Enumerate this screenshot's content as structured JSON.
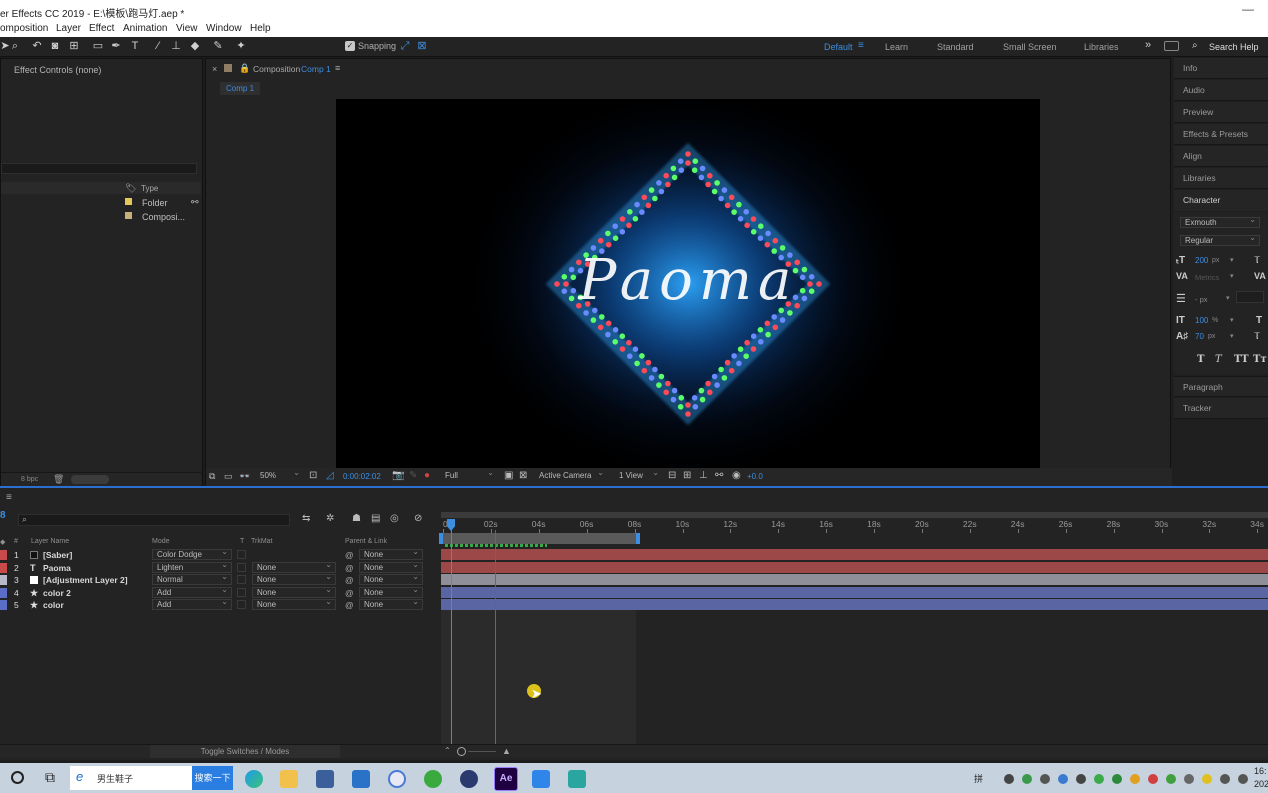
{
  "window": {
    "title": "er Effects CC 2019 - E:\\模板\\跑马灯.aep *",
    "minimize_glyph": "—"
  },
  "menu": [
    "omposition",
    "Layer",
    "Effect",
    "Animation",
    "View",
    "Window",
    "Help"
  ],
  "toolbar": {
    "snapping_label": "Snapping",
    "snapping_checked": true,
    "workspaces": [
      "Default",
      "Learn",
      "Standard",
      "Small Screen",
      "Libraries"
    ],
    "active_workspace": "Default",
    "search_label": "Search Help",
    "more_glyph": "»"
  },
  "effect_controls": {
    "title": "Effect Controls (none)"
  },
  "project": {
    "type_header": "Type",
    "items": [
      {
        "type": "Folder",
        "color": "#e3c95a"
      },
      {
        "type": "Composi...",
        "color": "#c9b07a"
      }
    ],
    "bpc": "8 bpc"
  },
  "composition": {
    "panel_label": "Composition",
    "comp_name": "Comp 1",
    "tab": "Comp 1",
    "artwork_text": "Paoma",
    "zoom": "50%",
    "timecode": "0:00:02:02",
    "resolution": "Full",
    "camera": "Active Camera",
    "views": "1 View",
    "exposure": "+0.0"
  },
  "right_panels": [
    "Info",
    "Audio",
    "Preview",
    "Effects & Presets",
    "Align",
    "Libraries",
    "Character"
  ],
  "character": {
    "font": "Exmouth",
    "style": "Regular",
    "size": "200",
    "size_unit": "px",
    "kerning": "Metrics",
    "leading": "- px",
    "scale_v": "100",
    "scale_unit": "%",
    "baseline": "70",
    "baseline_unit": "px",
    "style_buttons": [
      "T",
      "T",
      "TT",
      "Tт"
    ]
  },
  "right_panels_bottom": [
    "Paragraph",
    "Tracker"
  ],
  "timeline": {
    "columns": {
      "num": "#",
      "layer_name": "Layer Name",
      "mode": "Mode",
      "t": "T",
      "trkmat": "TrkMat",
      "parent": "Parent & Link"
    },
    "layers": [
      {
        "num": "1",
        "icon": "solid",
        "name": "[Saber]",
        "mode": "Color Dodge",
        "trkmat": "",
        "parent": "None",
        "label_color": "#c84a4a",
        "bar_color": "#9d4848"
      },
      {
        "num": "2",
        "icon": "T",
        "name": "Paoma",
        "mode": "Lighten",
        "trkmat": "None",
        "parent": "None",
        "label_color": "#c84a4a",
        "bar_color": "#9d4848"
      },
      {
        "num": "3",
        "icon": "adjust",
        "name": "[Adjustment Layer 2]",
        "mode": "Normal",
        "trkmat": "None",
        "parent": "None",
        "label_color": "#b8b8c8",
        "bar_color": "#8e8f99"
      },
      {
        "num": "4",
        "icon": "★",
        "name": "color 2",
        "mode": "Add",
        "trkmat": "None",
        "parent": "None",
        "label_color": "#5a6ec8",
        "bar_color": "#5a66a3"
      },
      {
        "num": "5",
        "icon": "★",
        "name": "color",
        "mode": "Add",
        "trkmat": "None",
        "parent": "None",
        "label_color": "#5a6ec8",
        "bar_color": "#5a66a3"
      }
    ],
    "ruler": [
      "0s",
      "02s",
      "04s",
      "06s",
      "08s",
      "10s",
      "12s",
      "14s",
      "16s",
      "18s",
      "20s",
      "22s",
      "24s",
      "26s",
      "28s",
      "30s",
      "32s",
      "34s"
    ],
    "toggle_label": "Toggle Switches / Modes"
  },
  "taskbar": {
    "search_text": "男生鞋子",
    "search_button": "搜索一下",
    "ime": "拼",
    "clock": "16:",
    "date": "202"
  }
}
